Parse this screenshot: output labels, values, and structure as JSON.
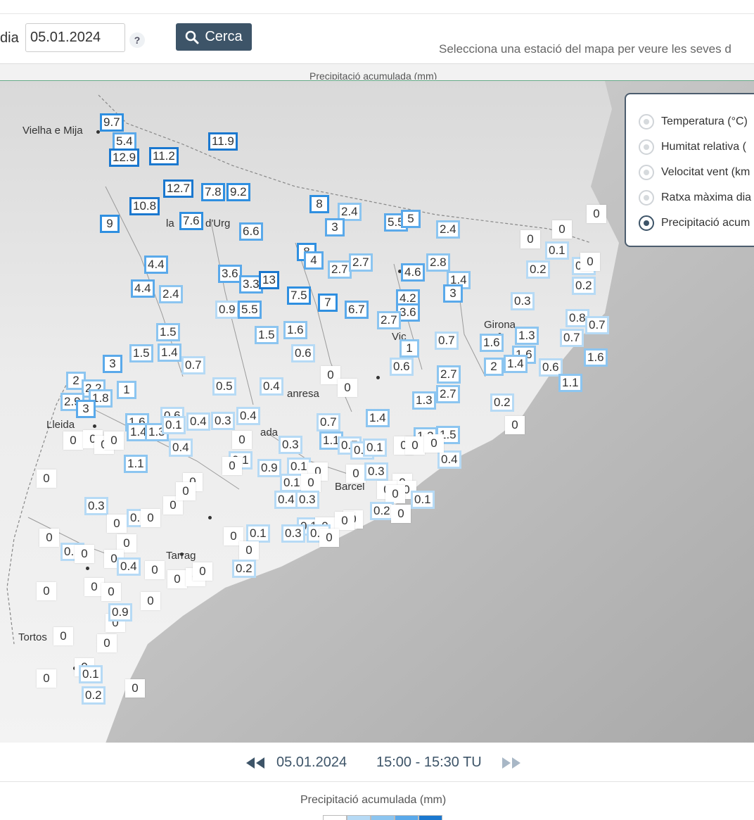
{
  "search": {
    "dia_label": "dia",
    "date_value": "05.01.2024",
    "help_label": "?",
    "button_label": "Cerca",
    "hint": "Selecciona una estació del mapa per veure les seves d"
  },
  "map": {
    "title": "Precipitació acumulada (mm)",
    "cities": [
      "Vielha e Mija",
      "la",
      "d'Urg",
      "anresa",
      "Lleida",
      "ada",
      "Barcel",
      "Tarrag",
      "Tortos",
      "Vic",
      "Girona"
    ],
    "stations": [
      "9.7",
      "5.4",
      "12.9",
      "11.2",
      "11.9",
      "12.7",
      "7.8",
      "9.2",
      "10.8",
      "9",
      "7.6",
      "6.6",
      "8",
      "2.4",
      "3",
      "5.5",
      "5",
      "2.4",
      "0",
      "0",
      "0.1",
      "0",
      "8",
      "4",
      "2.7",
      "2.7",
      "4.6",
      "2.8",
      "0.2",
      "0.1",
      "0",
      "4.4",
      "3.6",
      "3.3",
      "13",
      "7.5",
      "7",
      "6.7",
      "4.2",
      "3.6",
      "1.4",
      "3",
      "0.2",
      "4.4",
      "2.4",
      "0.9",
      "5.5",
      "2.7",
      "0.3",
      "0.8",
      "0.7",
      "1.5",
      "1.5",
      "1.6",
      "0.7",
      "1.6",
      "1.3",
      "0.7",
      "1.5",
      "1.4",
      "0.7",
      "0.6",
      "1",
      "1.6",
      "1.6",
      "3",
      "0",
      "0.6",
      "2.7",
      "2",
      "1.4",
      "0.6",
      "1.1",
      "2",
      "2.2",
      "1.8",
      "1",
      "0.5",
      "0.4",
      "0",
      "2.7",
      "2.9",
      "3",
      "1.6",
      "0.6",
      "0.4",
      "0.3",
      "0.4",
      "1.3",
      "0.2",
      "1.4",
      "1.3",
      "0.1",
      "0",
      "0.1",
      "0.3",
      "0.7",
      "1.4",
      "1.3",
      "1.5",
      "0.4",
      "0",
      "0",
      "0",
      "0",
      "0",
      "1.1",
      "0.4",
      "1.1",
      "0.7",
      "0.6",
      "0.1",
      "0",
      "0",
      "0",
      "0",
      "0",
      "0",
      "0.9",
      "0.1",
      "0",
      "0",
      "0.3",
      "0.1",
      "0",
      "0",
      "0",
      "0",
      "0.3",
      "0.1",
      "0",
      "0.1",
      "0",
      "0",
      "0.4",
      "0.3",
      "0",
      "0",
      "0.1",
      "0",
      "0",
      "0",
      "0.2",
      "0",
      "0",
      "0",
      "0",
      "0.1",
      "0",
      "0.3",
      "0.1",
      "0",
      "0.1",
      "0",
      "0",
      "0.4",
      "0",
      "0",
      "0",
      "0",
      "0",
      "0",
      "0.2",
      "0",
      "0",
      "0",
      "0.9",
      "0",
      "0",
      "0",
      "0.1",
      "0.2",
      "0",
      "0"
    ],
    "legend_dots_color": "#5ca8e8"
  },
  "layers": {
    "items": [
      {
        "label": "Temperatura (°C)",
        "selected": false
      },
      {
        "label": "Humitat relativa (",
        "selected": false
      },
      {
        "label": "Velocitat vent (km",
        "selected": false
      },
      {
        "label": "Ratxa màxima dia",
        "selected": false
      },
      {
        "label": "Precipitació acum",
        "selected": true
      }
    ]
  },
  "timebar": {
    "date": "05.01.2024",
    "range": "15:00 - 15:30 TU",
    "prev_icon": "rewind-icon",
    "next_icon": "fast-forward-icon"
  },
  "legend": {
    "title": "Precipitació acumulada (mm)",
    "colors": [
      "#ffffff",
      "#b6daf5",
      "#8cc5f0",
      "#5aa9ea",
      "#1b78cf"
    ]
  }
}
